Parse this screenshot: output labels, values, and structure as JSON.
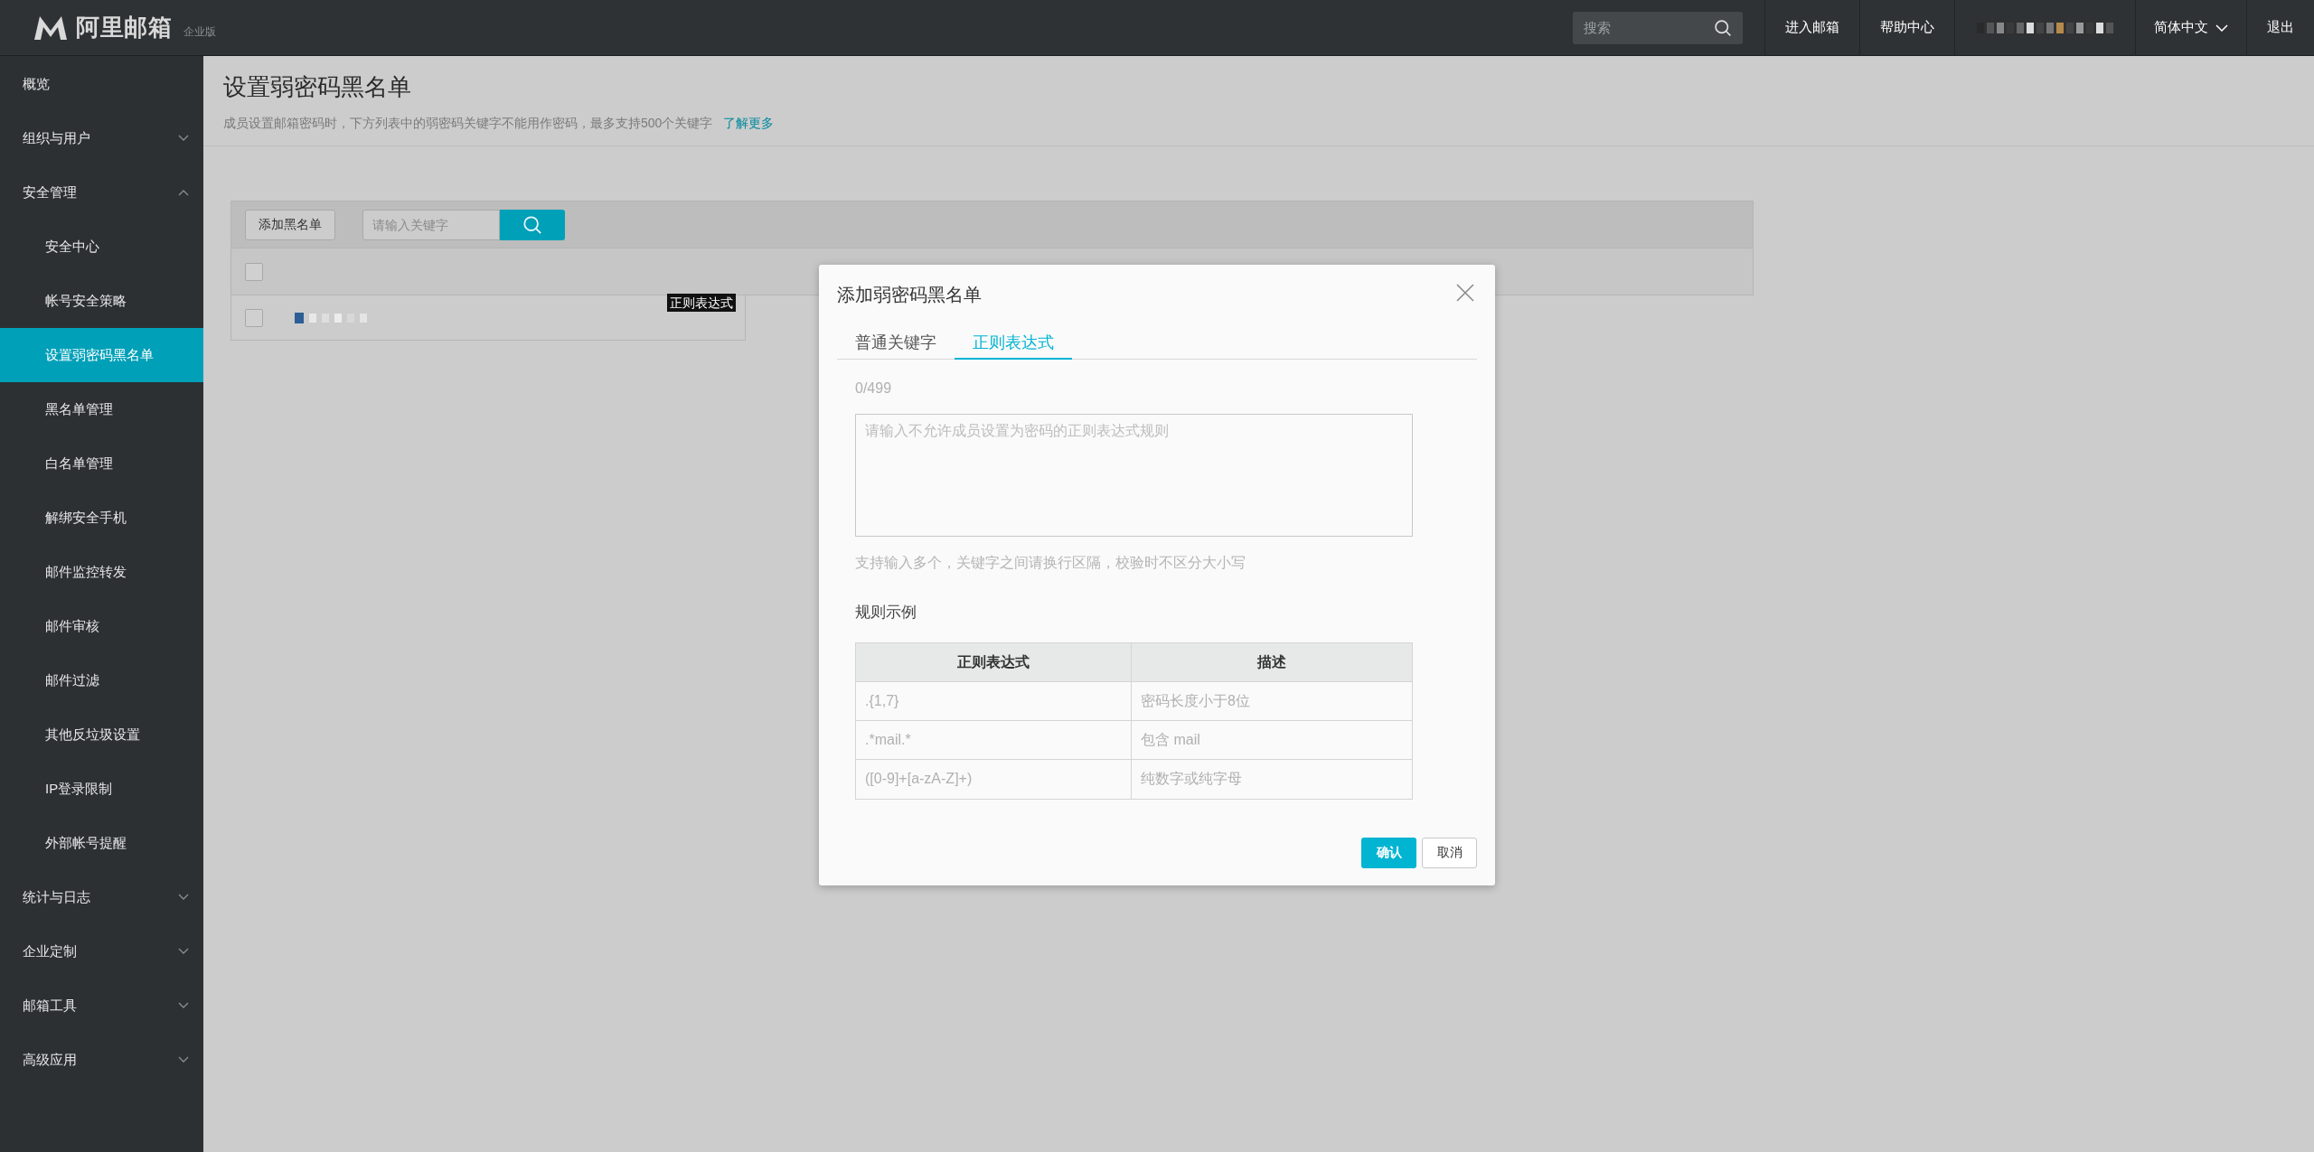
{
  "topbar": {
    "logo_text": "阿里邮箱",
    "edition": "企业版",
    "search": {
      "placeholder": "搜索"
    },
    "links": [
      "进入邮箱",
      "帮助中心"
    ],
    "language": "简体中文",
    "logout": "退出"
  },
  "sidebar": {
    "items": [
      {
        "label": "概览",
        "kind": "link",
        "selected": false
      },
      {
        "label": "组织与用户",
        "kind": "group",
        "selected": false,
        "expanded": false
      },
      {
        "label": "安全管理",
        "kind": "group",
        "selected": false,
        "expanded": true,
        "children": [
          {
            "label": "安全中心",
            "selected": false
          },
          {
            "label": "帐号安全策略",
            "selected": false
          },
          {
            "label": "设置弱密码黑名单",
            "selected": true
          },
          {
            "label": "黑名单管理",
            "selected": false
          },
          {
            "label": "白名单管理",
            "selected": false
          },
          {
            "label": "解绑安全手机",
            "selected": false
          },
          {
            "label": "邮件监控转发",
            "selected": false
          },
          {
            "label": "邮件审核",
            "selected": false
          },
          {
            "label": "邮件过滤",
            "selected": false
          },
          {
            "label": "其他反垃圾设置",
            "selected": false
          },
          {
            "label": "IP登录限制",
            "selected": false
          },
          {
            "label": "外部帐号提醒",
            "selected": false
          }
        ]
      },
      {
        "label": "统计与日志",
        "kind": "group",
        "selected": false,
        "expanded": false
      },
      {
        "label": "企业定制",
        "kind": "group",
        "selected": false,
        "expanded": false
      },
      {
        "label": "邮箱工具",
        "kind": "group",
        "selected": false,
        "expanded": false
      },
      {
        "label": "高级应用",
        "kind": "group",
        "selected": false,
        "expanded": false
      }
    ]
  },
  "page": {
    "title": "设置弱密码黑名单",
    "description": "成员设置邮箱密码时，下方列表中的弱密码关键字不能用作密码，最多支持500个关键字",
    "learn_more": "了解更多"
  },
  "toolbar": {
    "add_button": "添加黑名单",
    "search": {
      "placeholder": "请输入关键字"
    }
  },
  "table": {
    "header_checked": false,
    "rows": [
      {
        "checked": false,
        "tooltip": "正则表达式"
      }
    ]
  },
  "dialog": {
    "title": "添加弱密码黑名单",
    "tabs": [
      {
        "label": "普通关键字",
        "selected": false
      },
      {
        "label": "正则表达式",
        "selected": true
      }
    ],
    "counter": "0/499",
    "textarea": {
      "placeholder": "请输入不允许成员设置为密码的正则表达式规则"
    },
    "hint": "支持输入多个，关键字之间请换行区隔，校验时不区分大小写",
    "example_title": "规则示例",
    "example_table": {
      "columns": [
        "正则表达式",
        "描述"
      ],
      "rows": [
        [
          ".{1,7}",
          "密码长度小于8位"
        ],
        [
          ".*mail.*",
          "包含 mail"
        ],
        [
          "([0-9]+[a-zA-Z]+)",
          "纯数字或纯字母"
        ]
      ]
    },
    "confirm": "确认",
    "cancel": "取消"
  }
}
